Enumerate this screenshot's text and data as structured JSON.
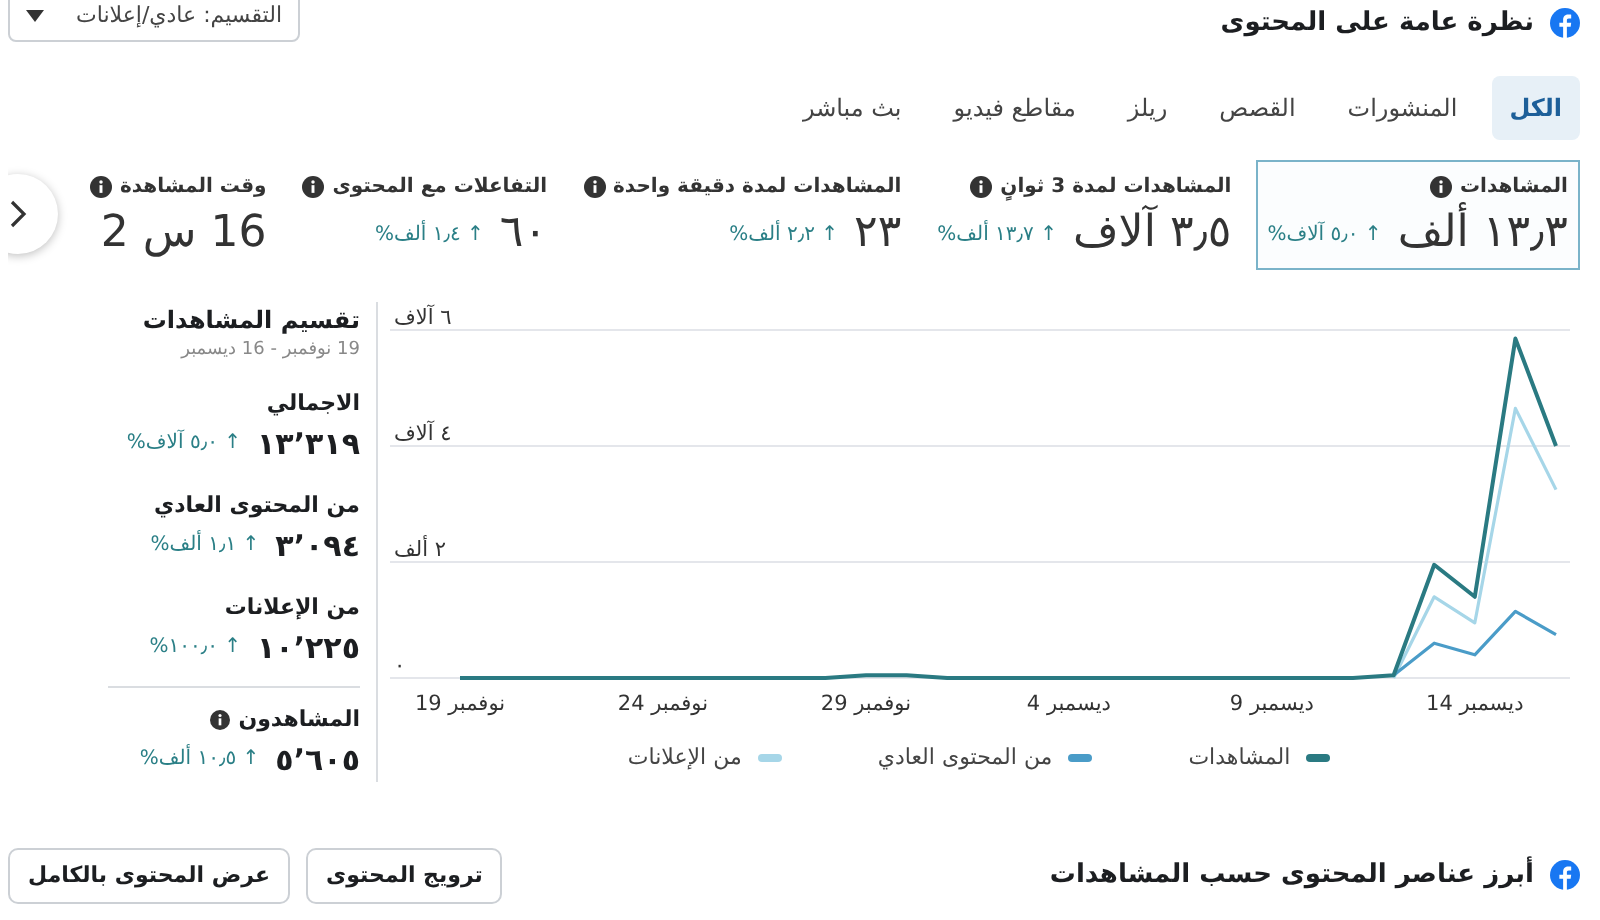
{
  "header": {
    "title": "نظرة عامة على المحتوى",
    "breakdown_dropdown": "التقسيم: عادي/إعلانات"
  },
  "tabs": [
    {
      "label": "الكل",
      "selected": true
    },
    {
      "label": "المنشورات",
      "selected": false
    },
    {
      "label": "القصص",
      "selected": false
    },
    {
      "label": "ريلز",
      "selected": false
    },
    {
      "label": "مقاطع فيديو",
      "selected": false
    },
    {
      "label": "بث مباشر",
      "selected": false
    }
  ],
  "metrics": [
    {
      "label": "المشاهدات",
      "value": "١٣٫٣ ألف",
      "change": "↑ ٥٫٠ آلاف%",
      "selected": true
    },
    {
      "label": "المشاهدات لمدة 3 ثوانٍ",
      "value": "٣٫٥ آلاف",
      "change": "↑ ١٣٫٧ ألف%",
      "selected": false
    },
    {
      "label": "المشاهدات لمدة دقيقة واحدة",
      "value": "٢٣",
      "change": "↑ ٢٫٢ ألف%",
      "selected": false
    },
    {
      "label": "التفاعلات مع المحتوى",
      "value": "٦٠",
      "change": "↑ ١٫٤ ألف%",
      "selected": false
    },
    {
      "label": "وقت المشاهدة",
      "value": "16 س 2",
      "selected": false
    }
  ],
  "chart": {
    "chart_data": {
      "type": "line",
      "categories": [
        "19 نوفمبر",
        null,
        null,
        null,
        null,
        "24 نوفمبر",
        null,
        null,
        null,
        null,
        "29 نوفمبر",
        null,
        null,
        null,
        null,
        "4 ديسمبر",
        null,
        null,
        null,
        null,
        "9 ديسمبر",
        null,
        null,
        null,
        null,
        "14 ديسمبر",
        null,
        null
      ],
      "ylim": [
        0,
        6
      ],
      "yticks": [
        {
          "value": 0,
          "label": "٠"
        },
        {
          "value": 2,
          "label": "٢ ألف"
        },
        {
          "value": 4,
          "label": "٤ آلاف"
        },
        {
          "value": 6,
          "label": "٦ آلاف"
        }
      ],
      "series": [
        {
          "name": "المشاهدات",
          "color": "#2a7a82",
          "values": [
            0,
            0,
            0,
            0,
            0,
            0,
            0,
            0,
            0,
            0,
            0.05,
            0.05,
            0,
            0,
            0,
            0,
            0,
            0,
            0,
            0,
            0,
            0,
            0,
            0.05,
            1.95,
            1.4,
            5.85,
            4.0
          ]
        },
        {
          "name": "من المحتوى العادي",
          "color": "#4a9cc8",
          "values": [
            null,
            null,
            null,
            null,
            null,
            null,
            null,
            null,
            null,
            null,
            null,
            null,
            null,
            null,
            null,
            null,
            null,
            null,
            null,
            null,
            null,
            null,
            null,
            0.05,
            0.6,
            0.4,
            1.15,
            0.75
          ]
        },
        {
          "name": "من الإعلانات",
          "color": "#a6d6e8",
          "values": [
            null,
            null,
            null,
            null,
            null,
            null,
            null,
            null,
            null,
            null,
            null,
            null,
            null,
            null,
            null,
            null,
            null,
            null,
            null,
            null,
            null,
            null,
            null,
            0,
            1.4,
            0.95,
            4.65,
            3.25
          ]
        }
      ]
    }
  },
  "breakdown": {
    "title": "تقسيم المشاهدات",
    "date_range": "19 نوفمبر - 16 ديسمبر",
    "rows": [
      {
        "label": "الاجمالي",
        "value": "١٣٬٣١٩",
        "change": "↑ ٥٫٠ آلاف%",
        "info": false
      },
      {
        "label": "من المحتوى العادي",
        "value": "٣٬٠٩٤",
        "change": "↑ ١٫١ ألف%",
        "info": false
      },
      {
        "label": "من الإعلانات",
        "value": "١٠٬٢٢٥",
        "change": "↑ ١٠٠٫٠%",
        "info": false
      },
      {
        "label": "المشاهدون",
        "value": "٥٬٦٠٥",
        "change": "↑ ١٠٫٥ ألف%",
        "info": true
      }
    ]
  },
  "footer": {
    "title": "أبرز عناصر المحتوى حسب المشاهدات",
    "buttons": [
      "ترويج المحتوى",
      "عرض المحتوى بالكامل"
    ]
  }
}
